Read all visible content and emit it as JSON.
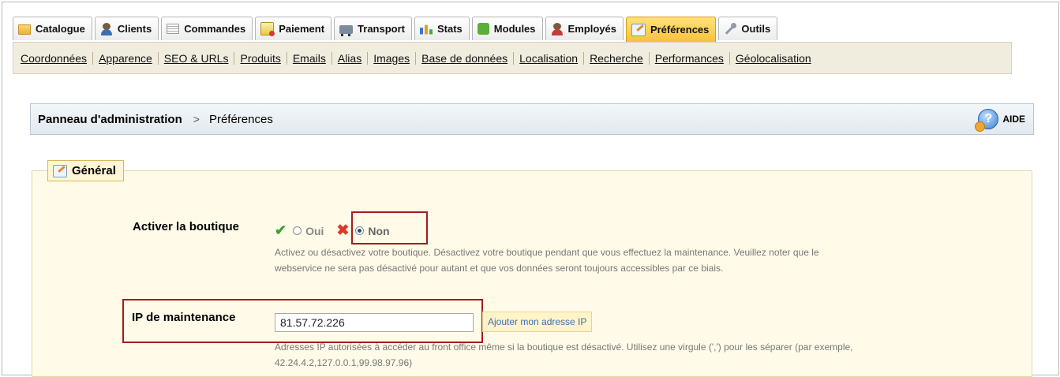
{
  "tabs": [
    {
      "label": "Catalogue",
      "icon": "folder-icon",
      "active": false
    },
    {
      "label": "Clients",
      "icon": "clients-icon",
      "active": false
    },
    {
      "label": "Commandes",
      "icon": "orders-icon",
      "active": false
    },
    {
      "label": "Paiement",
      "icon": "payment-icon",
      "active": false
    },
    {
      "label": "Transport",
      "icon": "truck-icon",
      "active": false
    },
    {
      "label": "Stats",
      "icon": "stats-icon",
      "active": false
    },
    {
      "label": "Modules",
      "icon": "puzzle-icon",
      "active": false
    },
    {
      "label": "Employés",
      "icon": "employees-icon",
      "active": false
    },
    {
      "label": "Préférences",
      "icon": "preferences-icon",
      "active": true
    },
    {
      "label": "Outils",
      "icon": "tools-icon",
      "active": false
    }
  ],
  "subnav": [
    "Coordonnées",
    "Apparence",
    "SEO & URLs",
    "Produits",
    "Emails",
    "Alias",
    "Images",
    "Base de données",
    "Localisation",
    "Recherche",
    "Performances",
    "Géolocalisation"
  ],
  "breadcrumb": {
    "root": "Panneau d'administration",
    "separator": ">",
    "current": "Préférences",
    "help_label": "AIDE"
  },
  "section": {
    "legend": "Général",
    "shop": {
      "label": "Activer la boutique",
      "option_yes": "Oui",
      "option_no": "Non",
      "selected": "Non",
      "help_line1": "Activez ou désactivez votre boutique. Désactivez votre boutique pendant que vous effectuez la maintenance. Veuillez noter que le",
      "help_line2": "webservice ne sera pas désactivé pour autant et que vos données seront toujours accessibles par ce biais."
    },
    "ip": {
      "label": "IP de maintenance",
      "value": "81.57.72.226",
      "button": "Ajouter mon adresse IP",
      "help_line1": "Adresses IP autorisées à accéder au front office même si la boutique est désactivé. Utilisez une virgule (',') pour les séparer (par exemple,",
      "help_line2": "42.24.4.2,127.0.0.1,99.98.97.96)"
    }
  },
  "colors": {
    "active_tab": "#f6c23a",
    "highlight_box": "#a61c1c",
    "link_blue": "#3b6fb0"
  }
}
